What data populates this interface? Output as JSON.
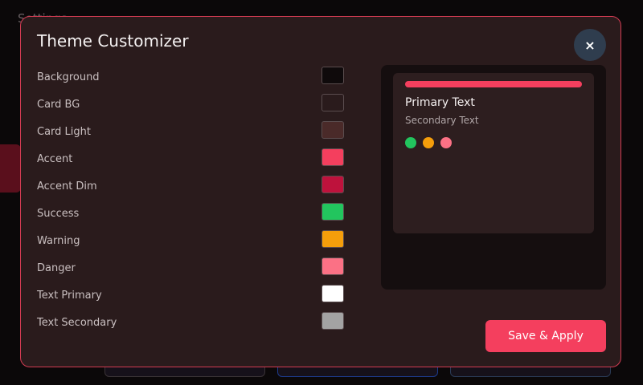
{
  "background": {
    "title": "Settings"
  },
  "modal": {
    "title": "Theme Customizer",
    "close_label": "×",
    "save_label": "Save & Apply"
  },
  "colors": [
    {
      "label": "Background",
      "value": "#0f0a0b"
    },
    {
      "label": "Card BG",
      "value": "#2a1b1c"
    },
    {
      "label": "Card Light",
      "value": "#4a2a29"
    },
    {
      "label": "Accent",
      "value": "#f43f5e"
    },
    {
      "label": "Accent Dim",
      "value": "#be123c"
    },
    {
      "label": "Success",
      "value": "#22c55e"
    },
    {
      "label": "Warning",
      "value": "#f59e0b"
    },
    {
      "label": "Danger",
      "value": "#fb7185"
    },
    {
      "label": "Text Primary",
      "value": "#ffffff"
    },
    {
      "label": "Text Secondary",
      "value": "#a3a3a3"
    }
  ],
  "preview": {
    "primary_text": "Primary Text",
    "secondary_text": "Secondary Text",
    "dots": [
      {
        "name": "success-dot",
        "color": "#22c55e"
      },
      {
        "name": "warning-dot",
        "color": "#f59e0b"
      },
      {
        "name": "danger-dot",
        "color": "#fb7185"
      }
    ]
  }
}
